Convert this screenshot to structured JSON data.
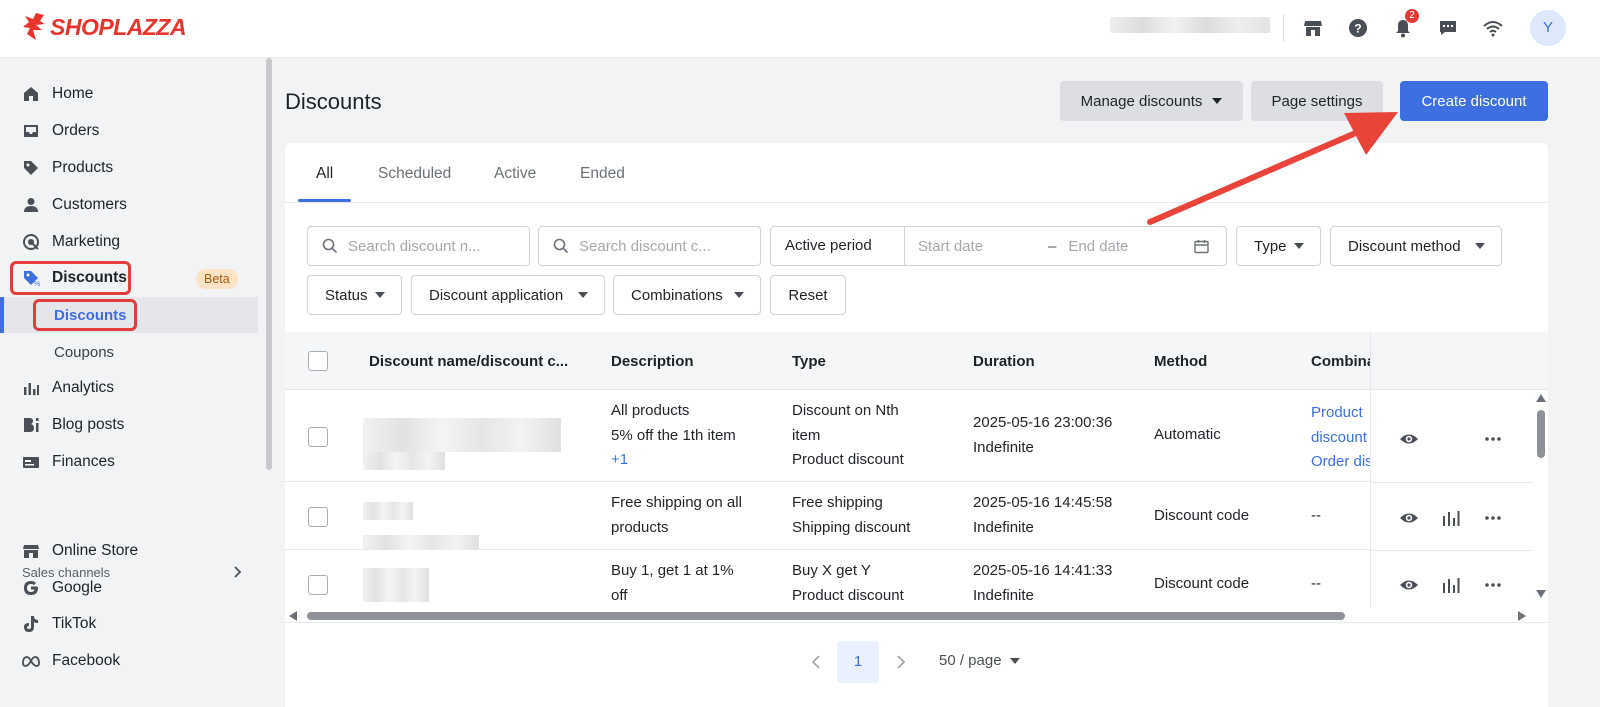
{
  "brand": {
    "name": "SHOPLAZZA",
    "color": "#e8352c"
  },
  "topbar": {
    "icons": [
      "store-icon",
      "help-icon",
      "bell-icon",
      "chat-icon",
      "wifi-icon"
    ],
    "notification_count": "2",
    "avatar_initial": "Y"
  },
  "sidebar": {
    "items": [
      {
        "label": "Home",
        "icon": "home-icon"
      },
      {
        "label": "Orders",
        "icon": "inbox-icon"
      },
      {
        "label": "Products",
        "icon": "tag-icon"
      },
      {
        "label": "Customers",
        "icon": "person-icon"
      },
      {
        "label": "Marketing",
        "icon": "marketing-icon"
      },
      {
        "label": "Discounts",
        "icon": "discount-icon",
        "badge": "Beta"
      },
      {
        "label": "Analytics",
        "icon": "bar-chart-icon"
      },
      {
        "label": "Blog posts",
        "icon": "blog-icon"
      },
      {
        "label": "Finances",
        "icon": "finance-icon"
      }
    ],
    "sub_items": [
      {
        "label": "Discounts",
        "active": true
      },
      {
        "label": "Coupons",
        "active": false
      }
    ],
    "sales_channels_title": "Sales channels",
    "channels": [
      {
        "label": "Online Store",
        "icon": "store-icon"
      },
      {
        "label": "Google",
        "icon": "google-icon"
      },
      {
        "label": "TikTok",
        "icon": "tiktok-icon"
      },
      {
        "label": "Facebook",
        "icon": "meta-icon"
      }
    ]
  },
  "header": {
    "title": "Discounts",
    "manage_label": "Manage discounts",
    "page_settings_label": "Page settings",
    "create_label": "Create discount"
  },
  "tabs": [
    "All",
    "Scheduled",
    "Active",
    "Ended"
  ],
  "filters": {
    "search_name_placeholder": "Search discount n...",
    "search_code_placeholder": "Search discount c...",
    "active_period_label": "Active period",
    "start_date_placeholder": "Start date",
    "date_separator": "–",
    "end_date_placeholder": "End date",
    "type_label": "Type",
    "discount_method_label": "Discount method",
    "status_label": "Status",
    "discount_application_label": "Discount application",
    "combinations_label": "Combinations",
    "reset_label": "Reset"
  },
  "table": {
    "columns": [
      "Discount name/discount c...",
      "Description",
      "Type",
      "Duration",
      "Method",
      "Combina"
    ],
    "rows": [
      {
        "description": [
          "All products",
          "5% off the 1th item"
        ],
        "description_more": "+1",
        "type": [
          "Discount on Nth",
          "item",
          "Product discount"
        ],
        "duration": [
          "2025-05-16 23:00:36",
          "Indefinite"
        ],
        "method": "Automatic",
        "combinations": [
          "Product",
          "discount",
          "Order dis"
        ]
      },
      {
        "description": [
          "Free shipping on all",
          "products"
        ],
        "type": [
          "Free shipping",
          "Shipping discount"
        ],
        "duration": [
          "2025-05-16 14:45:58",
          "Indefinite"
        ],
        "method": "Discount code",
        "combinations": [
          "--"
        ]
      },
      {
        "description": [
          "Buy 1, get 1 at 1%",
          "off"
        ],
        "type": [
          "Buy X get Y",
          "Product discount"
        ],
        "duration": [
          "2025-05-16 14:41:33",
          "Indefinite"
        ],
        "method": "Discount code",
        "combinations": [
          "--"
        ]
      }
    ]
  },
  "pagination": {
    "current_page": "1",
    "page_size": "50 / page"
  },
  "colors": {
    "accent": "#3d6fe0",
    "highlight": "#e23c3c",
    "beta_bg": "#fde2c4"
  }
}
